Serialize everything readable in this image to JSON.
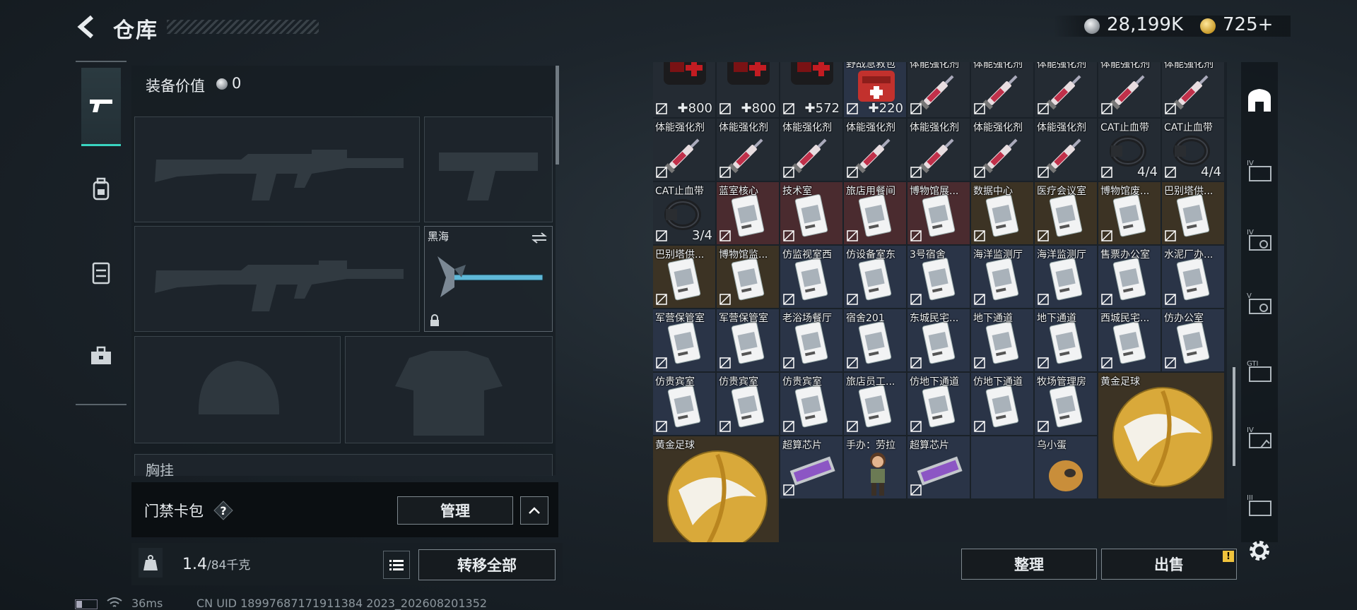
{
  "header": {
    "title": "仓库",
    "back_icon": "back-arrow-icon",
    "silver_amount": "28,199K",
    "gold_amount": "725",
    "gold_plus": "+"
  },
  "left_rail": {
    "tabs": [
      "pistol-icon",
      "backpack-icon",
      "vest-icon",
      "toolbox-icon"
    ],
    "accent": "#39d4c0"
  },
  "loadout": {
    "equip_value_label": "装备价值",
    "equip_value": "0",
    "melee_name": "黑海",
    "chest_label": "胸挂"
  },
  "card_pack": {
    "label": "门禁卡包",
    "help": "?",
    "manage": "管理"
  },
  "weight": {
    "current": "1.4",
    "max": "/84千克",
    "transfer_all": "转移全部"
  },
  "status": {
    "ping": "36ms",
    "uid": "CN UID 18997687171911384 2023_202608201352"
  },
  "warehouse": {
    "cells": [
      {
        "name": "",
        "qty": "800",
        "kind": "medkit",
        "bg": "dark",
        "plus": true
      },
      {
        "name": "",
        "qty": "800",
        "kind": "medkit",
        "bg": "dark",
        "plus": true
      },
      {
        "name": "",
        "qty": "572",
        "kind": "medkit",
        "bg": "dark",
        "plus": true
      },
      {
        "name": "野战急救包",
        "qty": "220",
        "kind": "medkit2",
        "bg": "blue",
        "plus": true
      },
      {
        "name": "体能强化剂",
        "qty": "",
        "kind": "syringe",
        "bg": "dark"
      },
      {
        "name": "体能强化剂",
        "qty": "",
        "kind": "syringe",
        "bg": "dark"
      },
      {
        "name": "体能强化剂",
        "qty": "",
        "kind": "syringe",
        "bg": "dark"
      },
      {
        "name": "体能强化剂",
        "qty": "",
        "kind": "syringe",
        "bg": "dark"
      },
      {
        "name": "体能强化剂",
        "qty": "",
        "kind": "syringe",
        "bg": "dark"
      },
      {
        "name": "体能强化剂",
        "qty": "",
        "kind": "syringe",
        "bg": "dark"
      },
      {
        "name": "体能强化剂",
        "qty": "",
        "kind": "syringe",
        "bg": "dark"
      },
      {
        "name": "体能强化剂",
        "qty": "",
        "kind": "syringe",
        "bg": "dark"
      },
      {
        "name": "体能强化剂",
        "qty": "",
        "kind": "syringe",
        "bg": "dark"
      },
      {
        "name": "体能强化剂",
        "qty": "",
        "kind": "syringe",
        "bg": "dark"
      },
      {
        "name": "体能强化剂",
        "qty": "",
        "kind": "syringe",
        "bg": "dark"
      },
      {
        "name": "体能强化剂",
        "qty": "",
        "kind": "syringe",
        "bg": "dark"
      },
      {
        "name": "CAT止血带",
        "qty": "4/4",
        "kind": "tourniquet",
        "bg": "dark"
      },
      {
        "name": "CAT止血带",
        "qty": "4/4",
        "kind": "tourniquet",
        "bg": "dark"
      },
      {
        "name": "CAT止血带",
        "qty": "3/4",
        "kind": "tourniquet",
        "bg": "dark"
      },
      {
        "name": "蓝室核心",
        "qty": "",
        "kind": "card",
        "bg": "red"
      },
      {
        "name": "技术室",
        "qty": "",
        "kind": "card",
        "bg": "red"
      },
      {
        "name": "旅店用餐间",
        "qty": "",
        "kind": "card",
        "bg": "red"
      },
      {
        "name": "博物馆展...",
        "qty": "",
        "kind": "card",
        "bg": "red"
      },
      {
        "name": "数据中心",
        "qty": "",
        "kind": "card",
        "bg": "gold"
      },
      {
        "name": "医疗会议室",
        "qty": "",
        "kind": "card",
        "bg": "gold"
      },
      {
        "name": "博物馆废...",
        "qty": "",
        "kind": "card",
        "bg": "gold"
      },
      {
        "name": "巴别塔供...",
        "qty": "",
        "kind": "card",
        "bg": "gold"
      },
      {
        "name": "巴别塔供...",
        "qty": "",
        "kind": "card",
        "bg": "gold"
      },
      {
        "name": "博物馆监...",
        "qty": "",
        "kind": "card",
        "bg": "gold"
      },
      {
        "name": "仿监视室西",
        "qty": "",
        "kind": "card",
        "bg": "blue"
      },
      {
        "name": "仿设备室东",
        "qty": "",
        "kind": "card",
        "bg": "blue"
      },
      {
        "name": "3号宿舍",
        "qty": "",
        "kind": "card",
        "bg": "blue"
      },
      {
        "name": "海洋监测厅",
        "qty": "",
        "kind": "card",
        "bg": "blue"
      },
      {
        "name": "海洋监测厅",
        "qty": "",
        "kind": "card",
        "bg": "blue"
      },
      {
        "name": "售票办公室",
        "qty": "",
        "kind": "card",
        "bg": "blue"
      },
      {
        "name": "水泥厂办...",
        "qty": "",
        "kind": "card",
        "bg": "blue"
      },
      {
        "name": "军营保管室",
        "qty": "",
        "kind": "card",
        "bg": "blue"
      },
      {
        "name": "军营保管室",
        "qty": "",
        "kind": "card",
        "bg": "blue"
      },
      {
        "name": "老浴场餐厅",
        "qty": "",
        "kind": "card",
        "bg": "blue"
      },
      {
        "name": "宿舍201",
        "qty": "",
        "kind": "card",
        "bg": "blue"
      },
      {
        "name": "东城民宅...",
        "qty": "",
        "kind": "card",
        "bg": "blue"
      },
      {
        "name": "地下通道",
        "qty": "",
        "kind": "card",
        "bg": "blue"
      },
      {
        "name": "地下通道",
        "qty": "",
        "kind": "card",
        "bg": "blue"
      },
      {
        "name": "西城民宅...",
        "qty": "",
        "kind": "card",
        "bg": "blue"
      },
      {
        "name": "仿办公室",
        "qty": "",
        "kind": "card",
        "bg": "blue"
      },
      {
        "name": "仿贵宾室",
        "qty": "",
        "kind": "card",
        "bg": "blue"
      },
      {
        "name": "仿贵宾室",
        "qty": "",
        "kind": "card",
        "bg": "blue"
      },
      {
        "name": "仿贵宾室",
        "qty": "",
        "kind": "card",
        "bg": "blue"
      },
      {
        "name": "旅店员工...",
        "qty": "",
        "kind": "card",
        "bg": "blue"
      },
      {
        "name": "仿地下通道",
        "qty": "",
        "kind": "card",
        "bg": "blue"
      },
      {
        "name": "仿地下通道",
        "qty": "",
        "kind": "card",
        "bg": "blue"
      },
      {
        "name": "牧场管理房",
        "qty": "",
        "kind": "card",
        "bg": "blue"
      },
      {
        "name": "黄金足球",
        "qty": "",
        "kind": "ball",
        "bg": "gold",
        "wide": true
      },
      {
        "name": "黄金足球",
        "qty": "",
        "kind": "ball",
        "bg": "gold",
        "wide": true
      },
      {
        "name": "超算芯片",
        "qty": "",
        "kind": "chip",
        "bg": "blue"
      },
      {
        "name": "手办：劳拉",
        "qty": "",
        "kind": "figure",
        "bg": "blue"
      },
      {
        "name": "超算芯片",
        "qty": "",
        "kind": "chip",
        "bg": "blue"
      },
      {
        "name": "",
        "qty": "",
        "kind": "empty",
        "bg": "blue"
      },
      {
        "name": "乌小蛋",
        "qty": "",
        "kind": "egg",
        "bg": "blue"
      }
    ]
  },
  "right_rail": {
    "tabs": [
      "home-icon",
      "case-iv-icon",
      "case-iv-camera-icon",
      "case-v-icon",
      "case-gti-icon",
      "case-iv-hand-icon",
      "case-iii-icon"
    ]
  },
  "actions": {
    "sort": "整理",
    "sell": "出售",
    "sell_alert": "!"
  },
  "colors": {
    "accent_teal": "#39d4c0",
    "silver": "#c9ced2",
    "gold": "#d9a93a",
    "alert_yellow": "#f0c33c"
  }
}
